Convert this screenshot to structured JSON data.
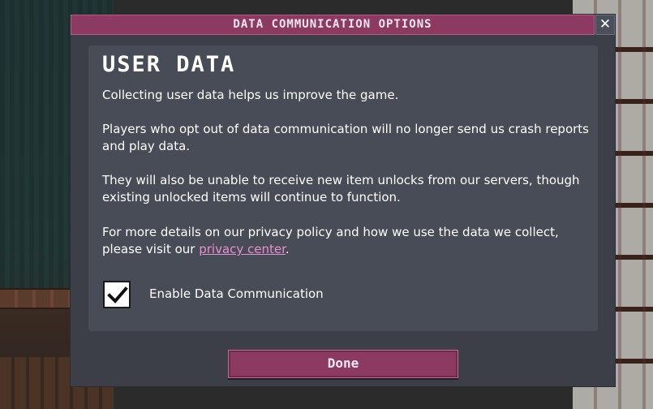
{
  "dialog": {
    "title": "DATA COMMUNICATION OPTIONS",
    "close_glyph": "✕",
    "close_icon": "close-icon"
  },
  "panel": {
    "heading": "USER DATA",
    "paragraph_1": "Collecting user data helps us improve the game.",
    "paragraph_2": "Players who opt out of data communication will no longer send us crash reports and play data.",
    "paragraph_3": "They will also be unable to receive new item unlocks from our servers, though existing unlocked items will continue to function.",
    "paragraph_4_prefix": "For more details on our privacy policy and how we use the data we collect, please visit our ",
    "paragraph_4_link": "privacy center",
    "paragraph_4_suffix": "."
  },
  "checkbox": {
    "label": "Enable Data Communication",
    "checked": true,
    "icon": "checkmark-icon"
  },
  "footer": {
    "done_label": "Done"
  },
  "colors": {
    "accent": "#8c3a62",
    "link": "#e88fd0",
    "dialog_bg": "#3c3f48",
    "panel_bg": "#484c56"
  }
}
